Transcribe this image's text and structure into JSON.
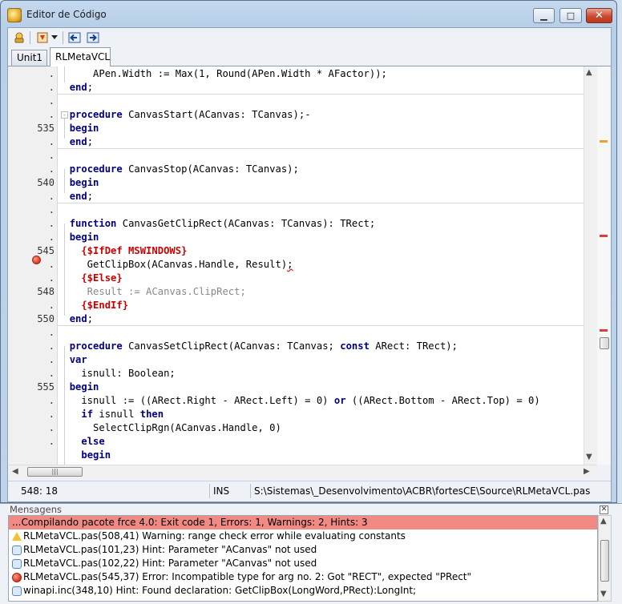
{
  "window": {
    "title": "Editor de Código",
    "minimize_glyph": "▁",
    "maximize_glyph": "□",
    "close_glyph": "✕"
  },
  "toolbar": {
    "icons": [
      "run-icon",
      "bookmark-icon",
      "dropdown-arrow-icon",
      "navigate-back-icon",
      "navigate-forward-icon"
    ]
  },
  "tabs": [
    {
      "label": "Unit1",
      "active": false
    },
    {
      "label": "RLMetaVCL",
      "active": true
    }
  ],
  "gutter": [
    {
      "text": "."
    },
    {
      "text": "."
    },
    {
      "text": "."
    },
    {
      "text": "."
    },
    {
      "text": "535"
    },
    {
      "text": "."
    },
    {
      "text": "."
    },
    {
      "text": "."
    },
    {
      "text": "540"
    },
    {
      "text": "."
    },
    {
      "text": "."
    },
    {
      "text": "."
    },
    {
      "text": "."
    },
    {
      "text": "545",
      "error": true
    },
    {
      "text": "."
    },
    {
      "text": "."
    },
    {
      "text": "548"
    },
    {
      "text": "."
    },
    {
      "text": "550"
    },
    {
      "text": "."
    },
    {
      "text": "."
    },
    {
      "text": "."
    },
    {
      "text": "."
    },
    {
      "text": "555"
    },
    {
      "text": "."
    },
    {
      "text": "."
    },
    {
      "text": "."
    },
    {
      "text": "."
    }
  ],
  "code_lines": [
    "      APen.Width := Max(1, Round(APen.Width * AFactor));",
    "  end;",
    "",
    "  procedure CanvasStart(ACanvas: TCanvas);",
    "  begin",
    "  end;",
    "",
    "  procedure CanvasStop(ACanvas: TCanvas);",
    "  begin",
    "  end;",
    "",
    "  function CanvasGetClipRect(ACanvas: TCanvas): TRect;",
    "  begin",
    "    {$IfDef MSWINDOWS}",
    "     GetClipBox(ACanvas.Handle, Result);",
    "    {$Else}",
    "     Result := ACanvas.ClipRect;",
    "    {$EndIf}",
    "  end;",
    "",
    "  procedure CanvasSetClipRect(ACanvas: TCanvas; const ARect: TRect);",
    "  var",
    "    isnull: Boolean;",
    "  begin",
    "    isnull := ((ARect.Right - ARect.Left) = 0) or ((ARect.Bottom - ARect.Top) = 0)",
    "    if isnull then",
    "      SelectClipRgn(ACanvas.Handle, 0)",
    "    else",
    "    begin"
  ],
  "status": {
    "position": "548: 18",
    "mode": "INS",
    "file_path": "S:\\Sistemas\\_Desenvolvimento\\ACBR\\fortesCE\\Source\\RLMetaVCL.pas"
  },
  "messages": {
    "title": "Mensagens",
    "items": [
      {
        "text": "...Compilando pacote frce 4.0: Exit code 1, Errors: 1, Warnings: 2, Hints: 3",
        "type": "summary",
        "highlight": true
      },
      {
        "text": "RLMetaVCL.pas(508,41) Warning: range check error while evaluating constants",
        "type": "warning"
      },
      {
        "text": "RLMetaVCL.pas(101,23) Hint: Parameter \"ACanvas\" not used",
        "type": "hint"
      },
      {
        "text": "RLMetaVCL.pas(102,22) Hint: Parameter \"ACanvas\" not used",
        "type": "hint"
      },
      {
        "text": "RLMetaVCL.pas(545,37) Error: Incompatible type for arg no. 2: Got \"RECT\", expected \"PRect\"",
        "type": "error"
      },
      {
        "text": "winapi.inc(348,10) Hint: Found declaration: GetClipBox(LongWord,PRect):LongInt;",
        "type": "hint"
      }
    ]
  },
  "colors": {
    "keyword": "#000080",
    "directive": "#cc0000",
    "error_highlight": "#f08a82",
    "accent_frame": "#c5d9ef"
  }
}
